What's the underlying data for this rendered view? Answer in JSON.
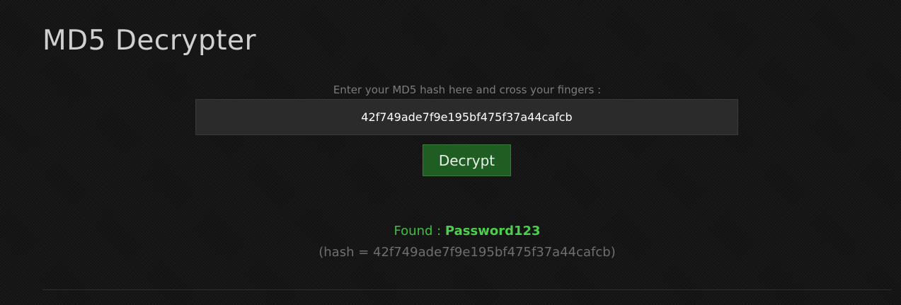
{
  "header": {
    "title": "MD5 Decrypter"
  },
  "form": {
    "prompt": "Enter your MD5 hash here and cross your fingers :",
    "hash_value": "42f749ade7f9e195bf475f37a44cafcb",
    "submit_label": "Decrypt"
  },
  "result": {
    "found_prefix": "Found : ",
    "found_value": "Password123",
    "hash_line": "(hash = 42f749ade7f9e195bf475f37a44cafcb)"
  },
  "colors": {
    "background": "#161616",
    "accent_green": "#3fbf3f",
    "button_green": "#1f5d23",
    "input_bg": "#2b2b2b"
  }
}
